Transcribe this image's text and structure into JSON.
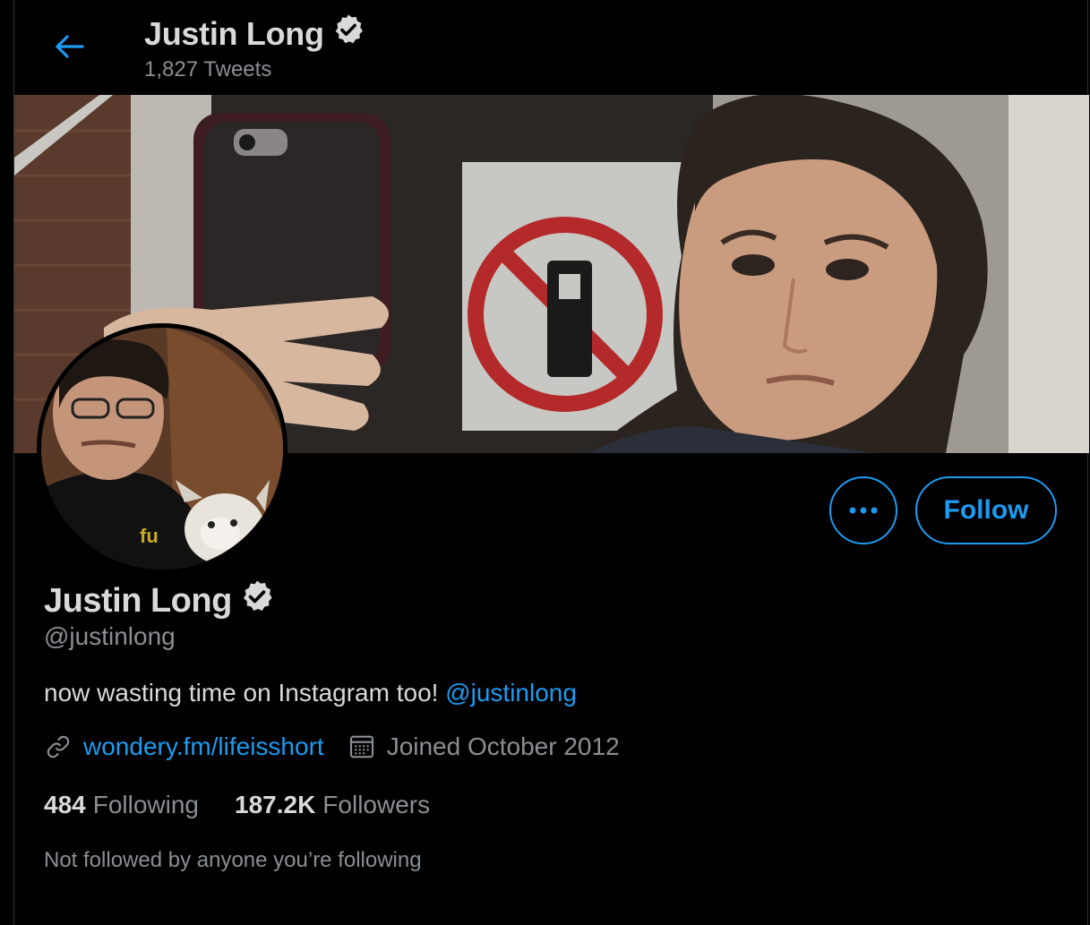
{
  "header": {
    "name": "Justin Long",
    "tweet_count": "1,827 Tweets"
  },
  "profile": {
    "name": "Justin Long",
    "handle": "@justinlong",
    "bio_text": "now wasting time on Instagram too! ",
    "bio_mention": "@justinlong",
    "website": "wondery.fm/lifeisshort",
    "joined": "Joined October 2012"
  },
  "actions": {
    "follow_label": "Follow",
    "more_icon": "more-icon"
  },
  "stats": {
    "following_count": "484",
    "following_label": "Following",
    "followers_count": "187.2K",
    "followers_label": "Followers"
  },
  "followed_by_note": "Not followed by anyone you’re following",
  "colors": {
    "accent": "#1d9bf0",
    "background": "#000000",
    "text_primary": "#d9d9d9",
    "text_secondary": "#8b8f94"
  }
}
